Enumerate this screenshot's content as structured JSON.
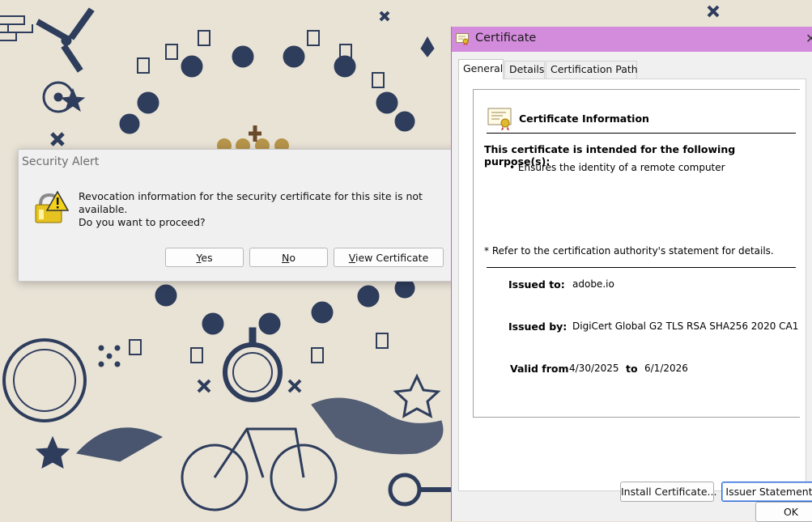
{
  "security_alert": {
    "title": "Security Alert",
    "message_line1": "Revocation information for the security certificate for this site is not available.",
    "message_line2": "Do you want to proceed?",
    "yes_mnemonic": "Y",
    "yes_rest": "es",
    "no_mnemonic": "N",
    "no_rest": "o",
    "view_mnemonic": "V",
    "view_rest": "iew Certificate"
  },
  "certificate": {
    "title": "Certificate",
    "close_glyph": "✕",
    "tabs": [
      {
        "label": "General",
        "active": true
      },
      {
        "label": "Details",
        "active": false
      },
      {
        "label": "Certification Path",
        "active": false
      }
    ],
    "heading": "Certificate Information",
    "purpose_heading": "This certificate is intended for the following purpose(s):",
    "purpose_item": "• Ensures the identity of a remote computer",
    "footnote": "* Refer to the certification authority's statement for details.",
    "issued_to_label": "Issued to:",
    "issued_to": "adobe.io",
    "issued_by_label": "Issued by:",
    "issued_by": "DigiCert Global G2 TLS RSA SHA256 2020 CA1",
    "valid_from_label": "Valid from",
    "valid_from": "4/30/2025",
    "valid_to_label": "to",
    "valid_to": "6/1/2026",
    "install_button": "Install Certificate...",
    "issuer_button": "Issuer Statement",
    "ok_button": "OK"
  },
  "colors": {
    "cert_titlebar": "#d38bdc",
    "wallpaper_bg": "#e9e3d6",
    "wallpaper_ink": "#2e3d5c",
    "warning_yellow": "#f3d21c"
  }
}
